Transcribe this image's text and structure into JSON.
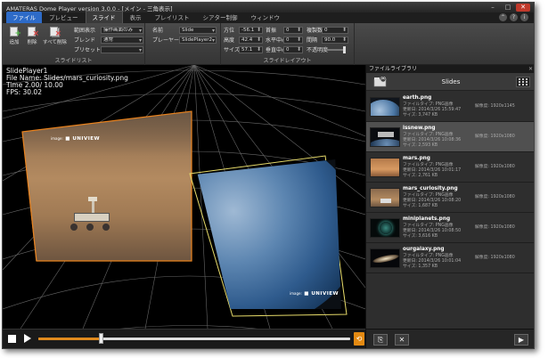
{
  "window": {
    "title": "AMATERAS Dome Player version 3.0.0 - [メイン - 三角表示]"
  },
  "menu": [
    "ファイル",
    "プレビュー",
    "スライド",
    "表示",
    "プレイリスト",
    "シアター制御",
    "ウィンドウ"
  ],
  "menu_active": "スライド",
  "ribbon": {
    "slidelist": {
      "add": "追加",
      "delete": "削除",
      "delete_all": "すべて削除",
      "caption": "スライドリスト",
      "range_label": "範囲表示",
      "range_value": "操作画面のみ",
      "blend_label": "ブレンド",
      "blend_value": "通常",
      "preset_label": "プリセット",
      "preset_value": ""
    },
    "player": {
      "name_label": "名前",
      "name_value": "Slide",
      "player_label": "プレーヤー",
      "player_value": "SlidePlayer2"
    },
    "layout": {
      "caption": "スライドレイアウト",
      "azimuth_label": "方位",
      "azimuth_value": "-56.1",
      "elevation_label": "高度",
      "elevation_value": "42.4",
      "size_label": "サイズ",
      "size_value": "57.1",
      "roll_label": "首振",
      "roll_value": "0",
      "hcenter_label": "水平中心",
      "hcenter_value": "0",
      "vcenter_label": "垂直中心",
      "vcenter_value": "0",
      "copies_label": "複製数",
      "copies_value": "0",
      "interval_label": "間隔",
      "interval_value": "90.0",
      "opacity_label": "不透明度"
    }
  },
  "viewport": {
    "player": "SlidePlayer1",
    "file": "File Name: Slides/mars_curiosity.png",
    "time": "Time    2.00/  10.00",
    "fps": "FPS: 30.02",
    "watermark": "UNIVIEW",
    "watermark_prefix": "image:"
  },
  "playback": {
    "progress": 0.2
  },
  "library": {
    "header": "ファイルライブラリ",
    "folder": "Slides",
    "items": [
      {
        "name": "earth.png",
        "type": "ファイルタイプ: PNG画像",
        "date": "更新日: 2014/3/26 15:59:47",
        "size": "サイズ: 3,747 KB",
        "res": "解像度: 1920x1145",
        "selected": false
      },
      {
        "name": "issnew.png",
        "type": "ファイルタイプ: PNG画像",
        "date": "更新日: 2014/3/26 10:08:36",
        "size": "サイズ: 2,593 KB",
        "res": "解像度: 1920x1080",
        "selected": true
      },
      {
        "name": "mars.png",
        "type": "ファイルタイプ: PNG画像",
        "date": "更新日: 2014/3/26 10:01:17",
        "size": "サイズ: 2,761 KB",
        "res": "解像度: 1920x1080",
        "selected": false
      },
      {
        "name": "mars_curiosity.png",
        "type": "ファイルタイプ: PNG画像",
        "date": "更新日: 2014/3/26 10:08:20",
        "size": "サイズ: 1,687 KB",
        "res": "解像度: 1920x1080",
        "selected": false
      },
      {
        "name": "miniplanets.png",
        "type": "ファイルタイプ: PNG画像",
        "date": "更新日: 2014/3/26 10:08:50",
        "size": "サイズ: 3,616 KB",
        "res": "解像度: 1920x1080",
        "selected": false
      },
      {
        "name": "ourgalaxy.png",
        "type": "ファイルタイプ: PNG画像",
        "date": "更新日: 2014/3/26 10:01:04",
        "size": "サイズ: 1,357 KB",
        "res": "解像度: 1920x1080",
        "selected": false
      }
    ]
  }
}
